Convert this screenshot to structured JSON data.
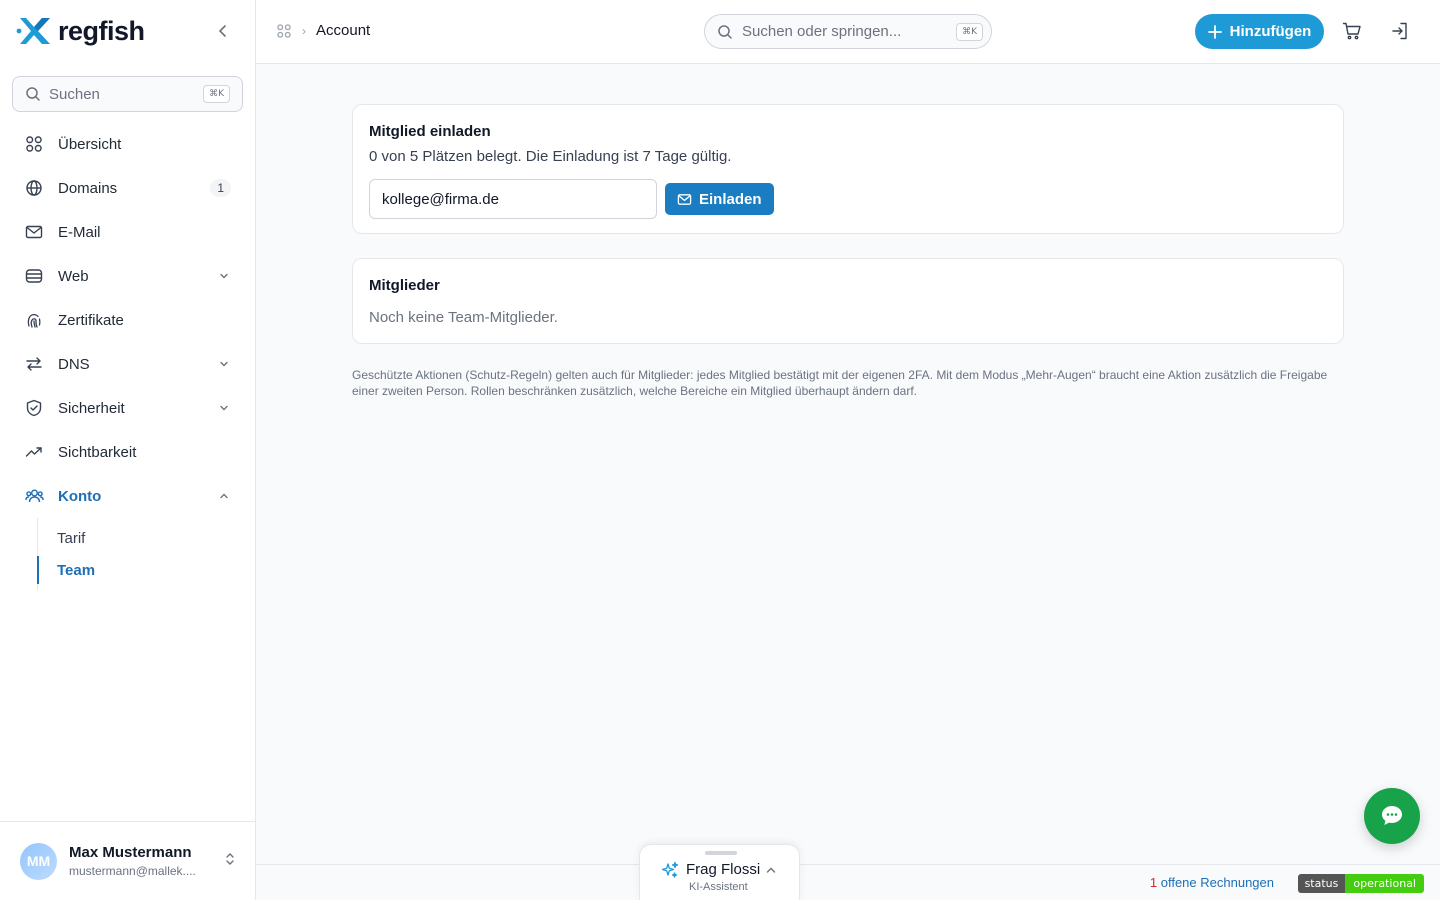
{
  "brand": {
    "name": "regfish"
  },
  "sidebar": {
    "search": {
      "placeholder": "Suchen",
      "shortcut": "⌘K"
    },
    "items": [
      {
        "label": "Übersicht",
        "icon": "grid-icon"
      },
      {
        "label": "Domains",
        "icon": "globe-icon",
        "badge": "1"
      },
      {
        "label": "E-Mail",
        "icon": "mail-icon"
      },
      {
        "label": "Web",
        "icon": "server-icon",
        "chevron": "down"
      },
      {
        "label": "Zertifikate",
        "icon": "fingerprint-icon"
      },
      {
        "label": "DNS",
        "icon": "arrows-icon",
        "chevron": "down"
      },
      {
        "label": "Sicherheit",
        "icon": "shield-icon",
        "chevron": "down"
      },
      {
        "label": "Sichtbarkeit",
        "icon": "trend-icon"
      },
      {
        "label": "Konto",
        "icon": "users-icon",
        "chevron": "up",
        "active": true
      }
    ],
    "subitems": [
      {
        "label": "Tarif"
      },
      {
        "label": "Team",
        "active": true
      }
    ],
    "user": {
      "initials": "MM",
      "name": "Max Mustermann",
      "email": "mustermann@mallek...."
    }
  },
  "header": {
    "breadcrumb": "Account",
    "search": {
      "placeholder": "Suchen oder springen...",
      "shortcut": "⌘K"
    },
    "add_label": "Hinzufügen"
  },
  "invite": {
    "title": "Mitglied einladen",
    "subtitle": "0 von 5 Plätzen belegt. Die Einladung ist 7 Tage gültig.",
    "email_value": "kollege@firma.de",
    "button_label": "Einladen"
  },
  "members": {
    "title": "Mitglieder",
    "empty": "Noch keine Team-Mitglieder."
  },
  "note": "Geschützte Aktionen (Schutz-Regeln) gelten auch für Mitglieder: jedes Mitglied bestätigt mit der eigenen 2FA. Mit dem Modus „Mehr-Augen“ braucht eine Aktion zusätzlich die Freigabe einer zweiten Person. Rollen beschränken zusätzlich, welche Bereiche ein Mitglied überhaupt ändern darf.",
  "footer": {
    "invoice_count": "1",
    "invoice_label": " offene Rechnungen",
    "status_key": "status",
    "status_value": "operational"
  },
  "assistant": {
    "title": "Frag Flossi",
    "subtitle": "KI-Assistent"
  },
  "colors": {
    "accent": "#1d6fb8",
    "primary_button": "#1e9ad6",
    "chat_fab": "#18a34a"
  }
}
